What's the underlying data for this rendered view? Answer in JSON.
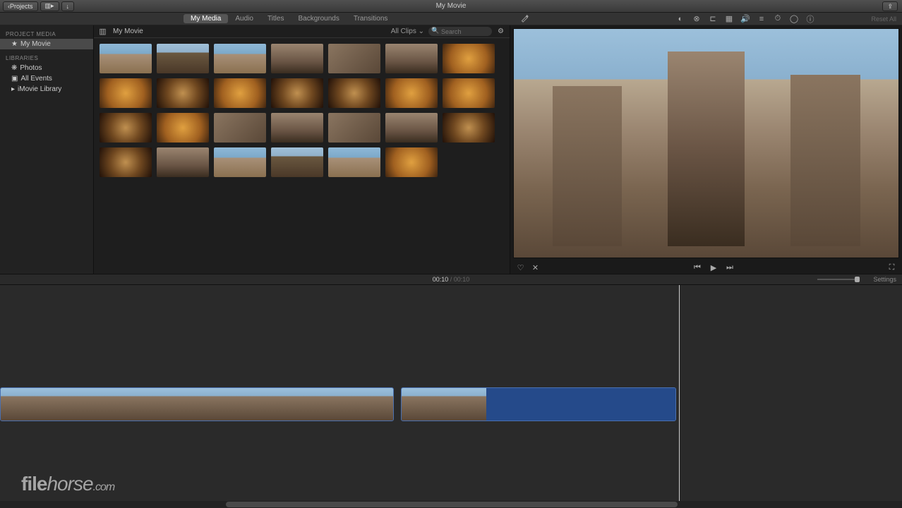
{
  "toolbar": {
    "back_label": "Projects",
    "title": "My Movie"
  },
  "tabs": {
    "items": [
      {
        "label": "My Media",
        "active": true
      },
      {
        "label": "Audio",
        "active": false
      },
      {
        "label": "Titles",
        "active": false
      },
      {
        "label": "Backgrounds",
        "active": false
      },
      {
        "label": "Transitions",
        "active": false
      }
    ]
  },
  "sidebar": {
    "section1": "PROJECT MEDIA",
    "item1": "My Movie",
    "section2": "LIBRARIES",
    "item2": "Photos",
    "item3": "All Events",
    "item4": "iMovie Library"
  },
  "browser": {
    "crumb": "My Movie",
    "filter": "All Clips",
    "search_placeholder": "Search",
    "thumbs": [
      "sky1",
      "sky2",
      "sky1",
      "stn1",
      "stn2",
      "stn1",
      "int1",
      "int1",
      "int2",
      "int1",
      "int2",
      "int2",
      "int1",
      "int1",
      "int2",
      "int1",
      "stn2",
      "stn1",
      "stn2",
      "stn1",
      "int2",
      "int2",
      "stn1",
      "sky1",
      "sky2",
      "sky1",
      "int1"
    ]
  },
  "viewer_tools": {
    "reset": "Reset All"
  },
  "timecode": {
    "current": "00:10",
    "total": "00:10",
    "settings": "Settings"
  },
  "watermark": {
    "brand1": "file",
    "brand2": "horse",
    "tld": ".com"
  }
}
